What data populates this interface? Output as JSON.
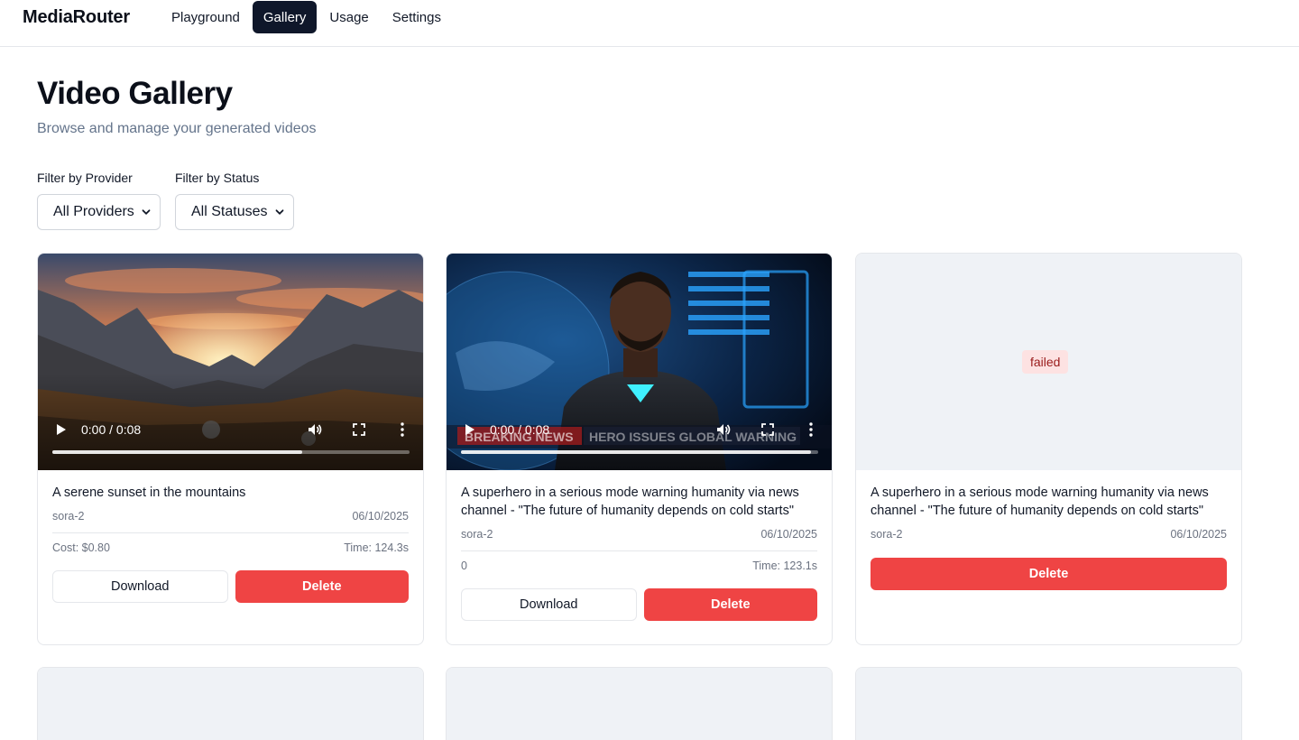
{
  "nav": {
    "brand": "MediaRouter",
    "items": [
      {
        "label": "Playground"
      },
      {
        "label": "Gallery"
      },
      {
        "label": "Usage"
      },
      {
        "label": "Settings"
      }
    ],
    "active": "Gallery"
  },
  "header": {
    "title": "Video Gallery",
    "subtitle": "Browse and manage your generated videos"
  },
  "filters": {
    "provider": {
      "label": "Filter by Provider",
      "value": "All Providers"
    },
    "status": {
      "label": "Filter by Status",
      "value": "All Statuses"
    }
  },
  "cards": [
    {
      "prompt": "A serene sunset in the mountains",
      "model": "sora-2",
      "date": "06/10/2025",
      "cost": "Cost: $0.80",
      "time": "Time: 124.3s",
      "timecode": "0:00 / 0:08",
      "progress": 0.7,
      "download_label": "Download",
      "delete_label": "Delete"
    },
    {
      "prompt": "A superhero in a serious mode warning humanity via news channel - \"The future of humanity depends on cold starts\"",
      "model": "sora-2",
      "date": "06/10/2025",
      "cost": "0",
      "time": "Time: 123.1s",
      "timecode": "0:00 / 0:08",
      "progress": 0.98,
      "overlay_left": "BREAKING NEWS",
      "overlay_right": "HERO ISSUES GLOBAL WARNING",
      "download_label": "Download",
      "delete_label": "Delete"
    },
    {
      "status": "failed",
      "prompt": "A superhero in a serious mode warning humanity via news channel - \"The future of humanity depends on cold starts\"",
      "model": "sora-2",
      "date": "06/10/2025",
      "delete_label": "Delete"
    }
  ],
  "colors": {
    "danger": "#ef4444",
    "nav_active": "#0f172a",
    "failed_bg": "#fde2e2",
    "failed_text": "#991b1b",
    "placeholder": "#eff2f6"
  }
}
